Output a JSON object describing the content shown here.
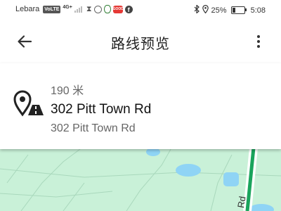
{
  "status_bar": {
    "carrier": "Lebara",
    "volte": "VoLTE",
    "network": "4G+",
    "battery_percent": "25%",
    "battery_level": 0.25,
    "time": "5:08",
    "app_badge": "GOOD",
    "facebook_glyph": "f"
  },
  "app_bar": {
    "title": "路线预览",
    "back_icon": "arrow-left",
    "menu_icon": "more-vert"
  },
  "route_card": {
    "icon": "destination-pin-road",
    "distance": "190 米",
    "destination_name": "302 Pitt Town Rd",
    "destination_address": "302 Pitt Town Rd"
  },
  "map": {
    "road_label": "Rd",
    "land_color": "#c9f1d8",
    "water_color": "#8fd4f5",
    "route_color": "#1aa45c"
  }
}
